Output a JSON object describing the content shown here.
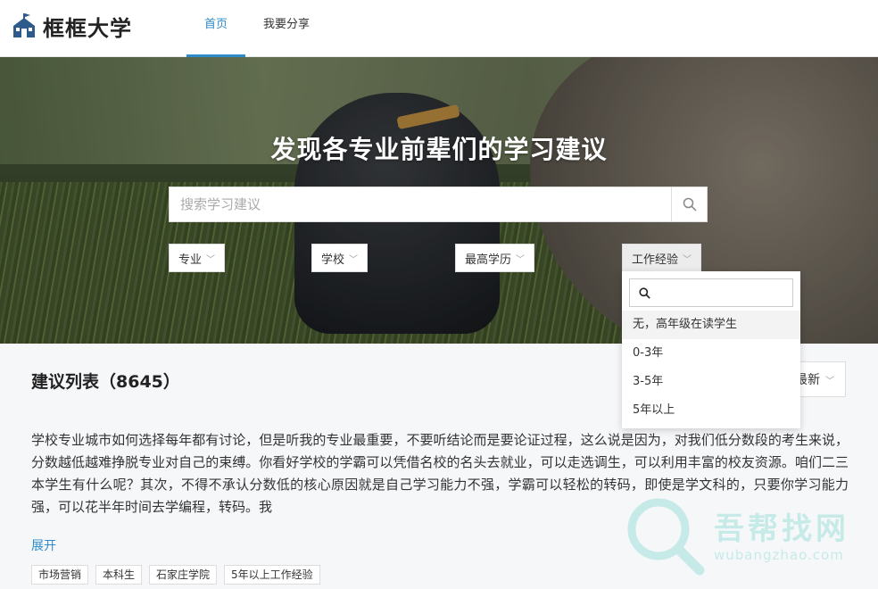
{
  "header": {
    "logo_text": "框框大学",
    "nav": [
      {
        "label": "首页",
        "active": true
      },
      {
        "label": "我要分享",
        "active": false
      }
    ]
  },
  "hero": {
    "title": "发现各专业前辈们的学习建议",
    "search_placeholder": "搜索学习建议",
    "filters": [
      "专业",
      "学校",
      "最高学历",
      "工作经验"
    ]
  },
  "dropdown": {
    "search_value": "",
    "options": [
      "无，高年级在读学生",
      "0-3年",
      "3-5年",
      "5年以上"
    ],
    "highlighted_index": 0
  },
  "list": {
    "title": "建议列表（8645）",
    "sort_label": "最新",
    "post": {
      "text": "学校专业城市如何选择每年都有讨论，但是听我的专业最重要，不要听结论而是要论证过程，这么说是因为，对我们低分数段的考生来说，分数越低越难挣脱专业对自己的束缚。你看好学校的学霸可以凭借名校的名头去就业，可以走选调生，可以利用丰富的校友资源。咱们二三本学生有什么呢？其次，不得不承认分数低的核心原因就是自己学习能力不强，学霸可以轻松的转码，即使是学文科的，只要你学习能力强，可以花半年时间去学编程，转码。我",
      "expand_label": "展开",
      "tags": [
        "市场营销",
        "本科生",
        "石家庄学院",
        "5年以上工作经验"
      ]
    }
  },
  "watermark": {
    "text": "吾帮找网",
    "sub": "wubangzhao.com"
  },
  "colors": {
    "accent": "#2e8bc9",
    "watermark": "#6fd3c8"
  }
}
